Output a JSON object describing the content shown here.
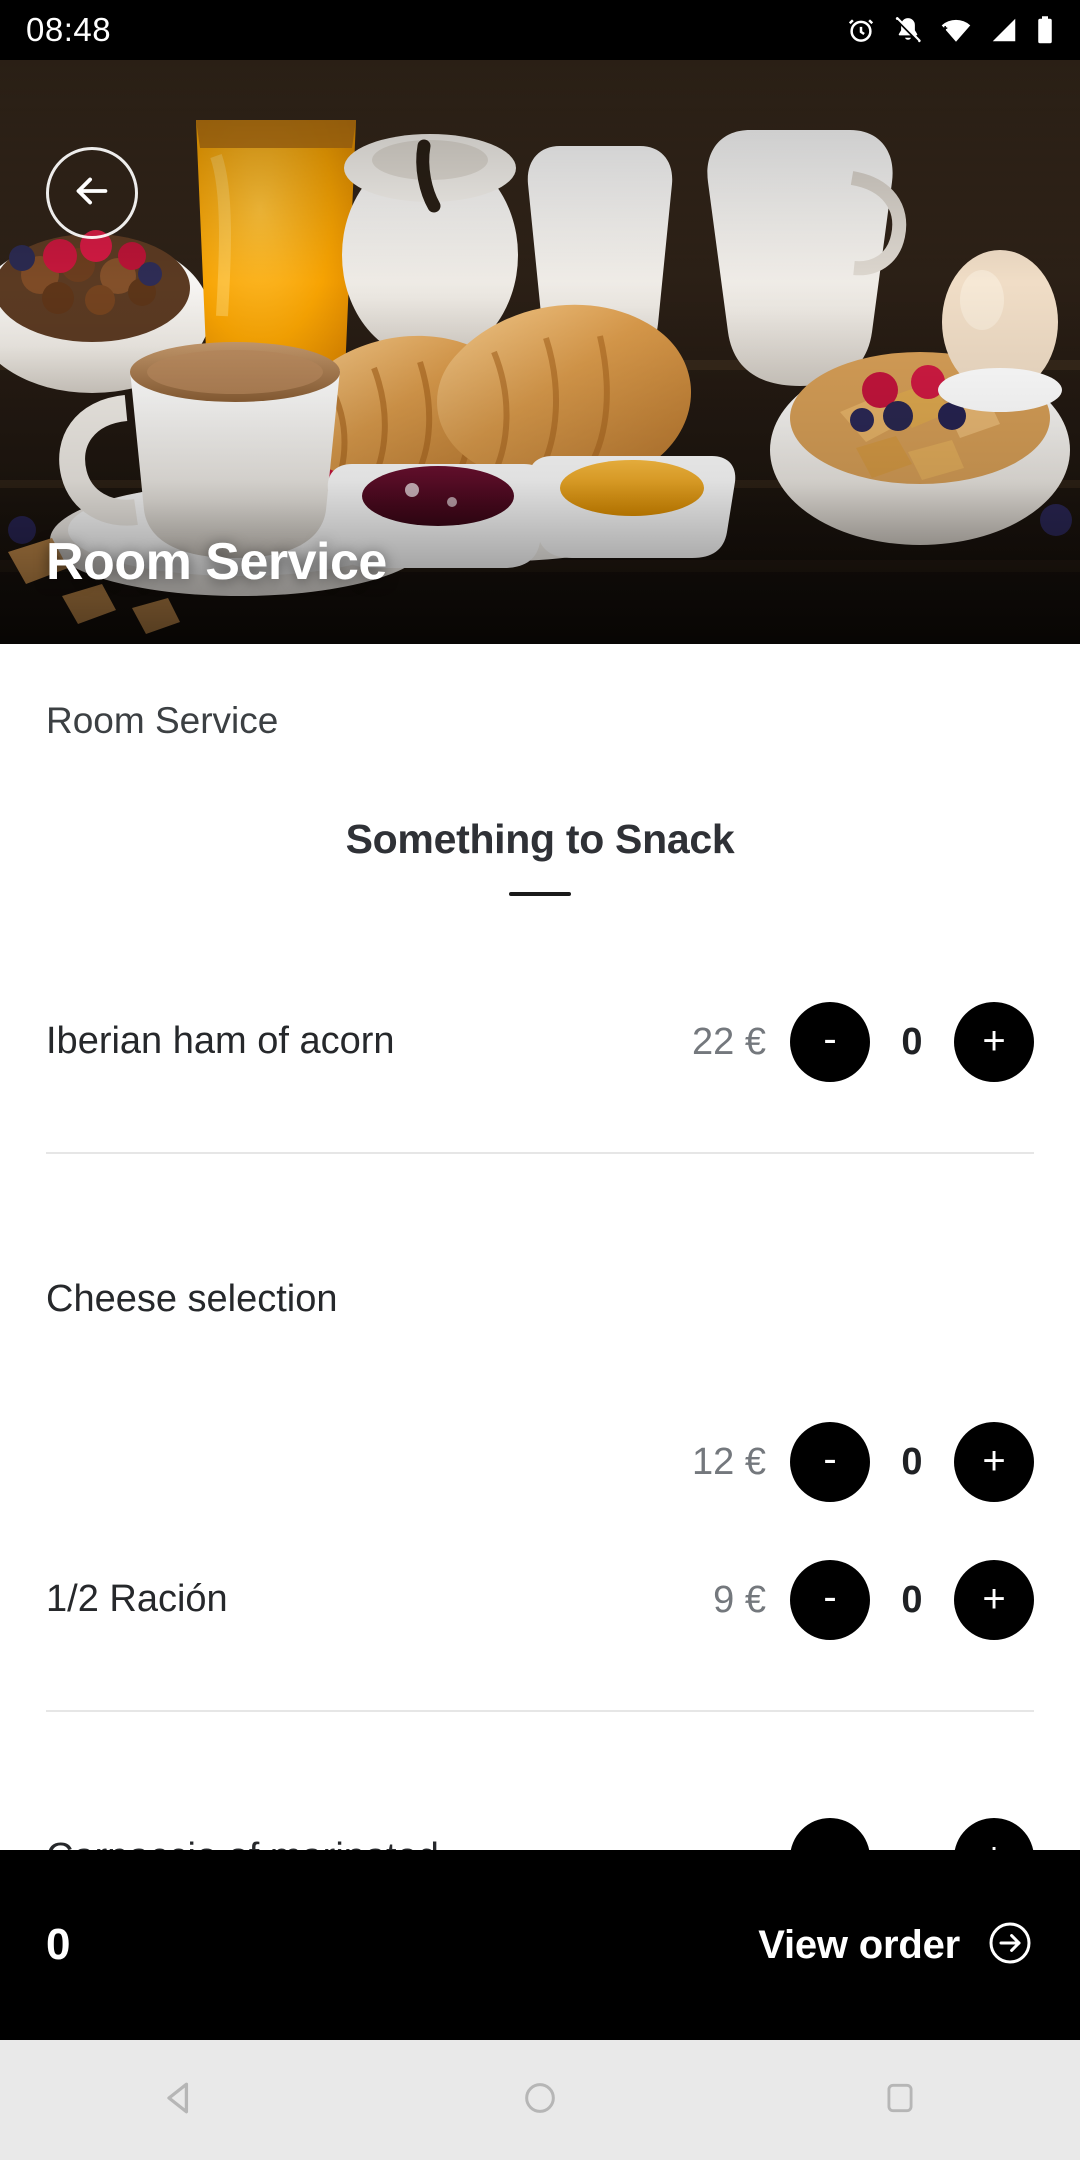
{
  "status_bar": {
    "time": "08:48",
    "icons": [
      "alarm-icon",
      "notifications-muted-icon",
      "wifi-icon",
      "cellular-signal-icon",
      "battery-icon"
    ]
  },
  "hero": {
    "title": "Room Service",
    "back_icon": "arrow-left-icon",
    "photo_alt": "breakfast-spread-photo"
  },
  "content": {
    "breadcrumb": "Room Service",
    "section": {
      "title": "Something to Snack"
    },
    "items": [
      {
        "name": "Iberian ham of acorn",
        "price": "22 €",
        "quantity": "0",
        "minus_label": "-",
        "plus_label": "+"
      },
      {
        "name": "Cheese selection",
        "price": "",
        "quantity": "",
        "minus_label": "-",
        "plus_label": "+"
      },
      {
        "name": "",
        "price": "12 €",
        "quantity": "0",
        "minus_label": "-",
        "plus_label": "+"
      },
      {
        "name": "1/2 Ración",
        "price": "9 €",
        "quantity": "0",
        "minus_label": "-",
        "plus_label": "+"
      },
      {
        "name": "Carpaccio of marinated",
        "price": "",
        "quantity": "",
        "minus_label": "-",
        "plus_label": "+"
      }
    ]
  },
  "order_bar": {
    "count": "0",
    "action_label": "View order",
    "action_icon": "arrow-right-circle-icon",
    "background": "#000000"
  },
  "nav_bar": {
    "back_icon": "triangle-back-icon",
    "home_icon": "circle-home-icon",
    "recents_icon": "square-recents-icon",
    "background": "#e9e9e9"
  },
  "colors": {
    "accent": "#000000",
    "price_text": "#74787d",
    "body_text": "#26282b",
    "divider": "#e6e6e6"
  }
}
